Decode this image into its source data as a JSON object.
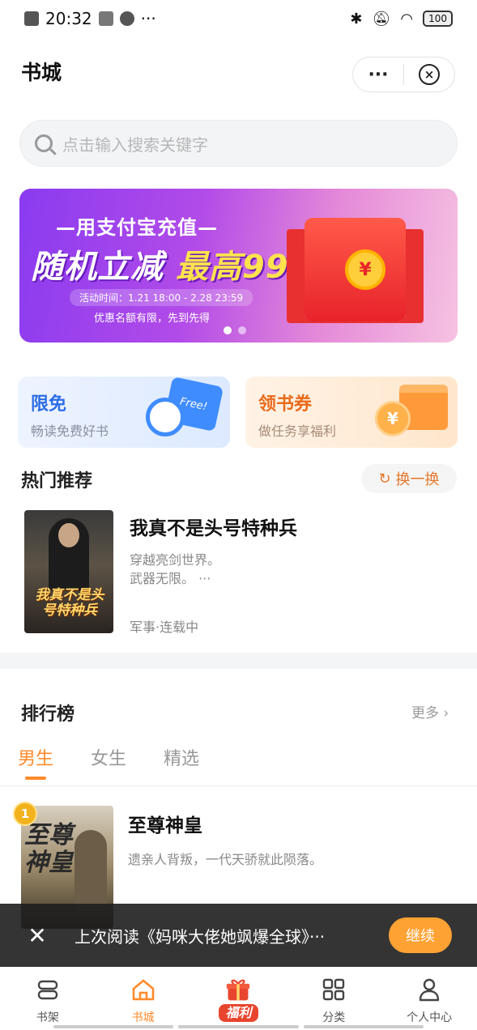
{
  "status_bar": {
    "time": "20:32",
    "more": "···",
    "battery": "100"
  },
  "header": {
    "title": "书城",
    "more_label": "···",
    "close_label": "×"
  },
  "search": {
    "placeholder": "点击输入搜索关键字"
  },
  "banner": {
    "line1": "—用支付宝充值—",
    "line2_a": "随机立减 ",
    "line2_b": "最高99元",
    "period": "活动时间：1.21 18:00 - 2.28 23:59",
    "note": "优惠名额有限，先到先得",
    "coin": "¥",
    "active_slide": 1,
    "slides": 2
  },
  "quick_cards": [
    {
      "title": "限免",
      "subtitle": "畅读免费好书",
      "icon_text": "Free!"
    },
    {
      "title": "领书券",
      "subtitle": "做任务享福利",
      "icon_text": "¥"
    }
  ],
  "hot": {
    "title": "热门推荐",
    "refresh_label": "换一换",
    "refresh_icon": "↻",
    "book": {
      "cover_text": "我真不是头号特种兵",
      "title": "我真不是头号特种兵",
      "desc_line1": "穿越亮剑世界。",
      "desc_line2": "武器无限。 ···",
      "tag": "军事·连载中"
    }
  },
  "ranking": {
    "title": "排行榜",
    "more_label": "更多 ›",
    "tabs": [
      "男生",
      "女生",
      "精选"
    ],
    "active_tab": 0,
    "items": [
      {
        "rank": "1",
        "cover_text": "至尊神皇",
        "title": "至尊神皇",
        "desc": "遗亲人背叛，一代天骄就此陨落。"
      }
    ]
  },
  "continue_reading": {
    "close_label": "✕",
    "text": "上次阅读《妈咪大佬她飒爆全球》···",
    "button": "继续"
  },
  "bottom_nav": [
    {
      "label": "书架",
      "icon": "bookshelf-icon"
    },
    {
      "label": "书城",
      "icon": "home-icon"
    },
    {
      "label": "福利",
      "icon": "gift-icon"
    },
    {
      "label": "分类",
      "icon": "grid-icon"
    },
    {
      "label": "个人中心",
      "icon": "user-icon"
    }
  ],
  "colors": {
    "accent": "#ff8a2a",
    "blue": "#2d6ee6",
    "red": "#e8452e"
  }
}
